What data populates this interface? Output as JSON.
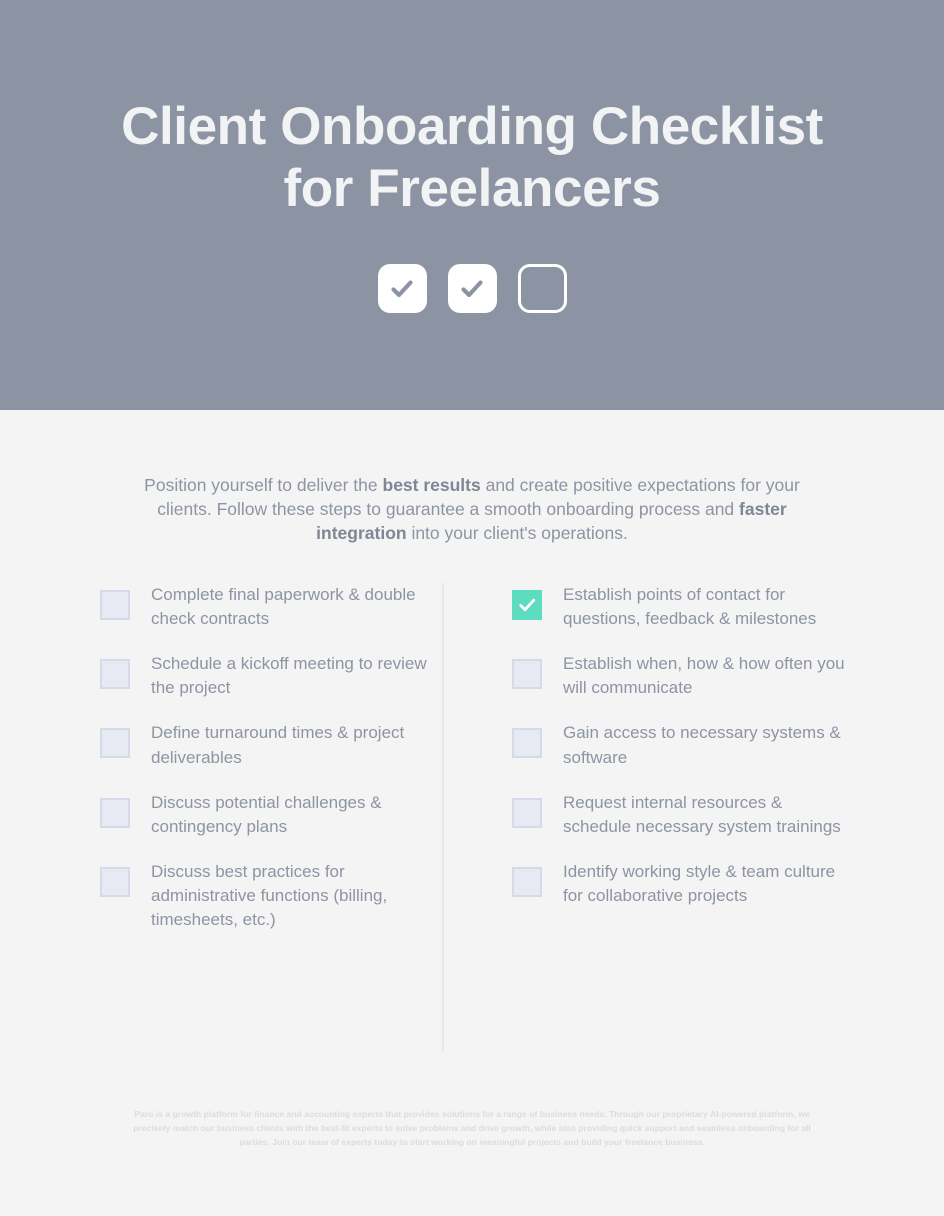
{
  "header": {
    "title_line_1": "Client Onboarding Checklist",
    "title_line_2": "for Freelancers",
    "background_color": "#8c94a3",
    "title_color": "#f2f3f5",
    "boxes": [
      {
        "state": "checked",
        "style": "filled-white"
      },
      {
        "state": "checked",
        "style": "filled-white"
      },
      {
        "state": "unchecked",
        "style": "outline-white"
      }
    ]
  },
  "intro": {
    "part_1": "Position yourself to deliver the ",
    "bold_1": "best results",
    "part_2": " and create positive expectations for your clients. Follow these steps to guarantee a smooth onboarding process and ",
    "bold_2": "faster integration",
    "part_3": " into your client's operations."
  },
  "checklist": {
    "accent_color": "#5ddcc0",
    "box_color": "#e7eaf3",
    "text_color": "#8d94a2",
    "left_column": [
      {
        "checked": false,
        "label": "Complete final paperwork & double check contracts"
      },
      {
        "checked": false,
        "label": "Schedule a kickoff meeting to review the project"
      },
      {
        "checked": false,
        "label": "Define turnaround times & project deliverables"
      },
      {
        "checked": false,
        "label": "Discuss potential challenges & contingency plans"
      },
      {
        "checked": false,
        "label": "Discuss best practices for administrative functions (billing, timesheets, etc.)"
      }
    ],
    "right_column": [
      {
        "checked": true,
        "label": "Establish points of contact for questions, feedback & milestones"
      },
      {
        "checked": false,
        "label": "Establish when, how & how often you will communicate"
      },
      {
        "checked": false,
        "label": "Gain access to necessary systems & software"
      },
      {
        "checked": false,
        "label": "Request internal resources & schedule necessary system trainings"
      },
      {
        "checked": false,
        "label": "Identify working style & team culture for collaborative projects"
      }
    ]
  },
  "footer": {
    "text": "Paro is a growth platform for finance and accounting experts that provides solutions for a range of business needs. Through our proprietary AI-powered platform, we precisely match our business clients with the best-fit experts to solve problems and drive growth, while also providing quick support and seamless onboarding for all parties. Join our team of experts today to start working on meaningful projects and build your freelance business."
  }
}
